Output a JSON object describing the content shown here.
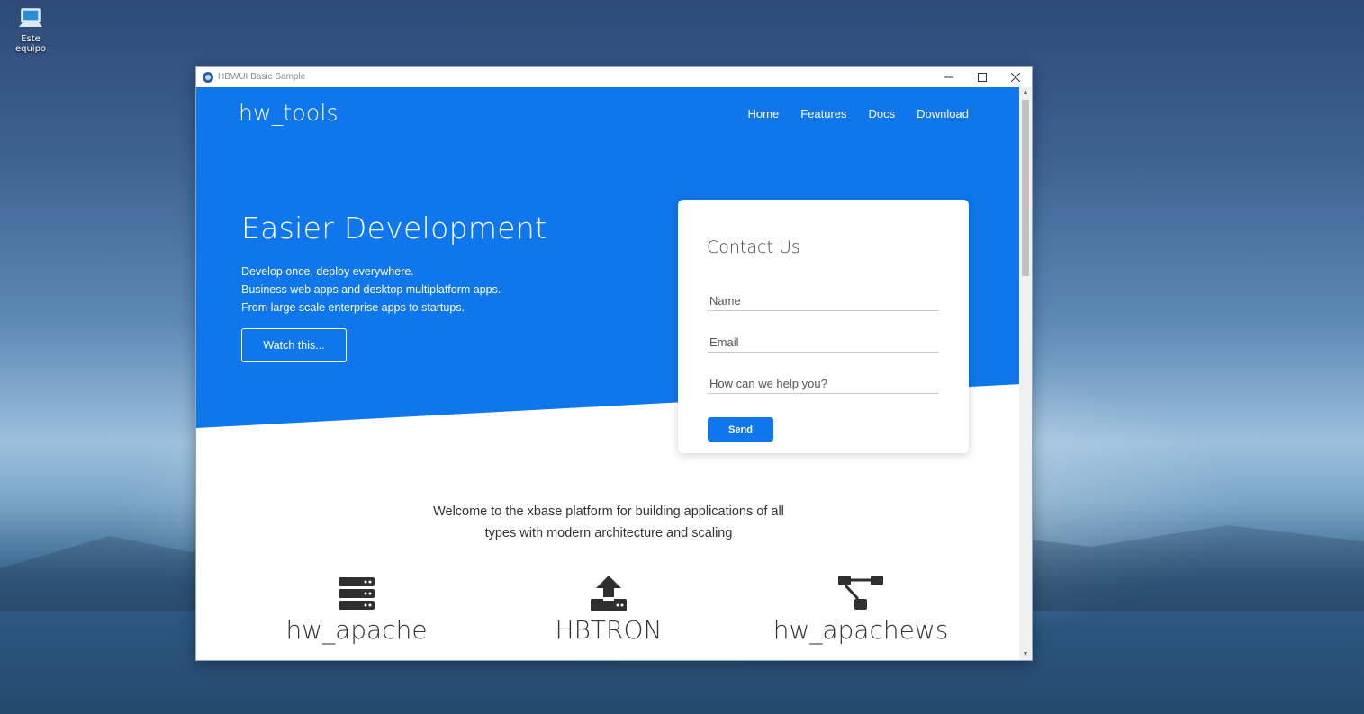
{
  "desktop": {
    "icon_label": "Este equipo"
  },
  "window": {
    "title": "HBWUI Basic Sample"
  },
  "nav": {
    "brand": "hw_tools",
    "links": [
      "Home",
      "Features",
      "Docs",
      "Download"
    ]
  },
  "hero": {
    "title": "Easier Development",
    "lines": [
      "Develop once, deploy everywhere.",
      "Business web apps and desktop multiplatform apps.",
      "From large scale enterprise apps to startups."
    ],
    "button_label": "Watch this..."
  },
  "contact": {
    "title": "Contact Us",
    "name_placeholder": "Name",
    "email_placeholder": "Email",
    "help_placeholder": "How can we help you?",
    "send_label": "Send"
  },
  "welcome": {
    "lines": [
      "Welcome to the xbase platform for building applications of all",
      "types with modern architecture and scaling"
    ]
  },
  "features": [
    {
      "name": "hw_apache",
      "icon": "server-icon"
    },
    {
      "name": "HBTRON",
      "icon": "upload-icon"
    },
    {
      "name": "hw_apachews",
      "icon": "network-icon"
    }
  ],
  "colors": {
    "accent": "#0f76ec"
  }
}
